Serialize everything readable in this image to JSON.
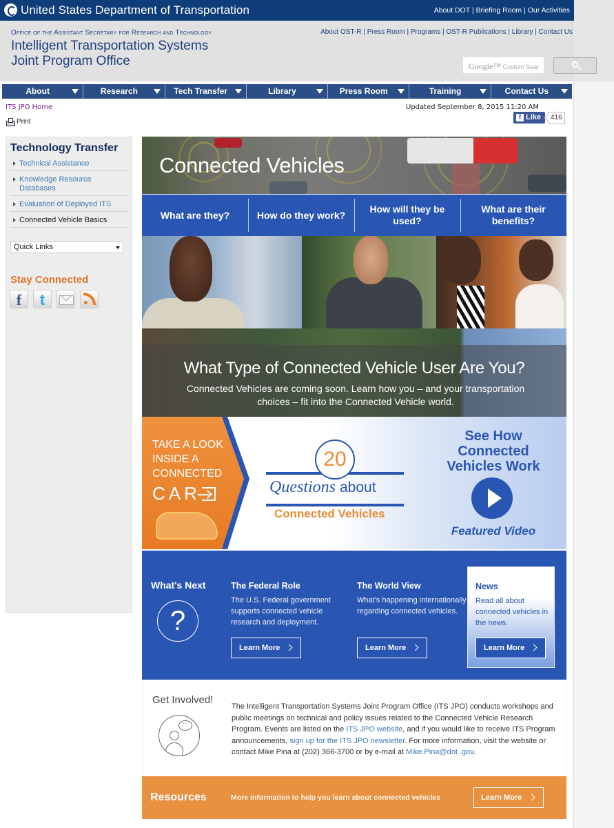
{
  "dot_bar": {
    "title": "United States Department of Transportation",
    "links": [
      "About DOT",
      "Briefing Room",
      "Our Activities"
    ]
  },
  "header": {
    "office": "Office of the Assistant Secretary for Research and Technology",
    "title_line1": "Intelligent Transportation Systems",
    "title_line2": "Joint Program Office",
    "links": [
      "About OST-R",
      "Press Room",
      "Programs",
      "OST-R Publications",
      "Library",
      "Contact Us"
    ],
    "search": {
      "brand": "Google™",
      "placeholder": "Custom Sear",
      "button_icon": "search-icon"
    }
  },
  "nav": {
    "items": [
      "About",
      "Research",
      "Tech Transfer",
      "Library",
      "Press Room",
      "Training",
      "Contact Us"
    ]
  },
  "breadcrumb": "ITS JPO Home",
  "print_label": "Print",
  "updated": "Updated September 8, 2015 11:20 AM",
  "facebook": {
    "label": "Like",
    "count": "416"
  },
  "sidebar": {
    "title": "Technology Transfer",
    "items": [
      {
        "label": "Technical Assistance",
        "active": false
      },
      {
        "label": "Knowledge Resource Databases",
        "active": false
      },
      {
        "label": "Evaluation of Deployed ITS",
        "active": false
      },
      {
        "label": "Connected Vehicle Basics",
        "active": true
      }
    ],
    "quick_links": "Quick Links",
    "stay_connected": "Stay Connected",
    "social": [
      "facebook-icon",
      "twitter-icon",
      "email-icon",
      "rss-icon"
    ]
  },
  "main": {
    "hero_title": "Connected Vehicles",
    "tabs": [
      "What are they?",
      "How do they work?",
      "How will they be used?",
      "What are their benefits?"
    ],
    "user_banner": {
      "title": "What Type of Connected Vehicle User Are You?",
      "text": "Connected Vehicles are coming soon.   Learn how you – and your transportation choices – fit into the Connected Vehicle world."
    },
    "promo": {
      "car_lines": [
        "TAKE A LOOK",
        "INSIDE A",
        "CONNECTED"
      ],
      "car_big": "CAR",
      "q_number": "20",
      "q_word": "Questions",
      "q_about": "about",
      "q_subject": "Connected Vehicles",
      "video_title": "See How Connected Vehicles Work",
      "video_caption": "Featured Video"
    },
    "whats_next": {
      "title": "What's Next",
      "columns": [
        {
          "heading": "The Federal Role",
          "text": "The U.S. Federal government supports connected vehicle research and deployment.",
          "button": "Learn More"
        },
        {
          "heading": "The World View",
          "text": "What's happening internationally regarding connected vehicles.",
          "button": "Learn More"
        }
      ],
      "news": {
        "heading": "News",
        "text": "Read all about connected vehicles in the news.",
        "button": "Learn More"
      }
    },
    "get_involved": {
      "title": "Get Involved!",
      "text_1": "The Intelligent Transportation Systems Joint Program Office (ITS JPO) conducts workshops and public meetings on technical and policy issues related to the Connected Vehicle Research Program. Events are listed on the ",
      "link_1": "ITS JPO website",
      "text_2": ", and if you would like to receive ITS Program announcements, ",
      "link_2": "sign up for the ITS JPO newsletter",
      "text_3": ". For more information, visit the website or contact Mike Pina at (202) 366-3700 or by e-mail at ",
      "link_3": "Mike.Pina@dot .gov",
      "text_4": "."
    },
    "resources": {
      "title": "Resources",
      "text": "More information to help you learn about connected vehicles",
      "button": "Learn More"
    }
  },
  "colors": {
    "dot_blue": "#0e3d7a",
    "nav_blue": "#2a4e85",
    "cv_blue": "#2a56b3",
    "orange": "#e89141",
    "link_blue": "#3f78b5",
    "stay_orange": "#e4742b"
  }
}
